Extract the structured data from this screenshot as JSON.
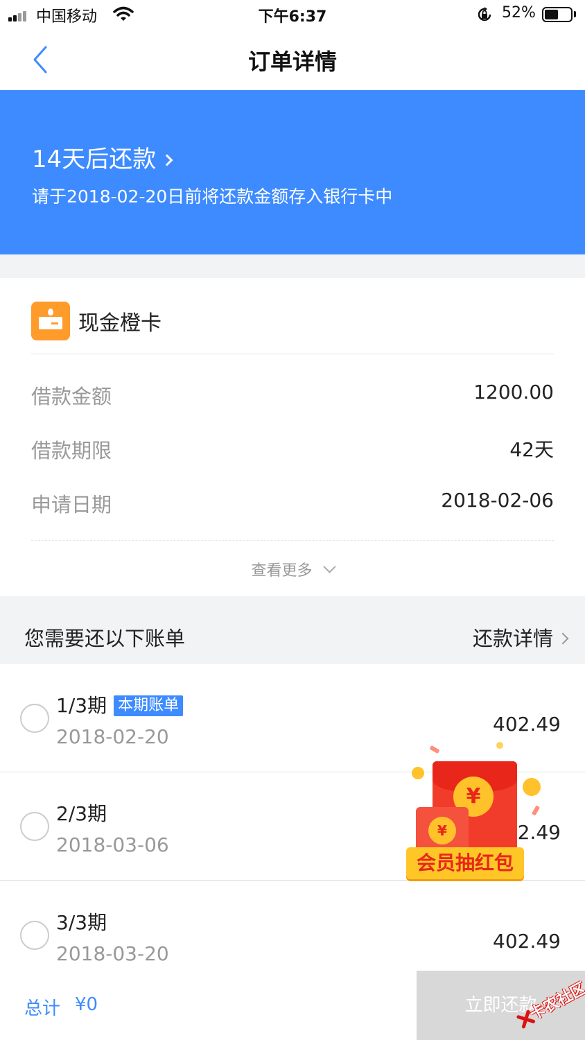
{
  "status_bar": {
    "carrier": "中国移动",
    "time": "下午6:37",
    "battery_percent": "52%",
    "battery_level": 0.52,
    "icons": [
      "signal-icon",
      "wifi-icon",
      "orientation-lock-icon",
      "battery-icon"
    ]
  },
  "nav": {
    "title": "订单详情",
    "back_icon": "chevron-left-icon"
  },
  "banner": {
    "title": "14天后还款",
    "subtitle": "请于2018-02-20日前将还款金额存入银行卡中",
    "background": "#3d8bff"
  },
  "product": {
    "name": "现金橙卡",
    "icon": "card-icon",
    "icon_color": "#ff9b2b"
  },
  "loan_info": [
    {
      "label": "借款金额",
      "value": "1200.00"
    },
    {
      "label": "借款期限",
      "value": "42天"
    },
    {
      "label": "申请日期",
      "value": "2018-02-06"
    }
  ],
  "see_more": "查看更多",
  "bills_section": {
    "title": "您需要还以下账单",
    "link": "还款详情"
  },
  "bills": [
    {
      "period": "1/3期",
      "tag": "本期账单",
      "date": "2018-02-20",
      "amount": "402.49"
    },
    {
      "period": "2/3期",
      "tag": "",
      "date": "2018-03-06",
      "amount": "402.49"
    },
    {
      "period": "3/3期",
      "tag": "",
      "date": "2018-03-20",
      "amount": "402.49"
    }
  ],
  "footer": {
    "total_label": "总计",
    "total_value": "¥0",
    "pay_button": "立即还款"
  },
  "red_packet": {
    "label": "会员抽红包",
    "coin_symbol": "¥"
  },
  "watermark": {
    "text": "卡农社区"
  },
  "colors": {
    "accent": "#3d8bff",
    "background": "#f2f3f5",
    "disabled_button": "#d8d8d8"
  }
}
